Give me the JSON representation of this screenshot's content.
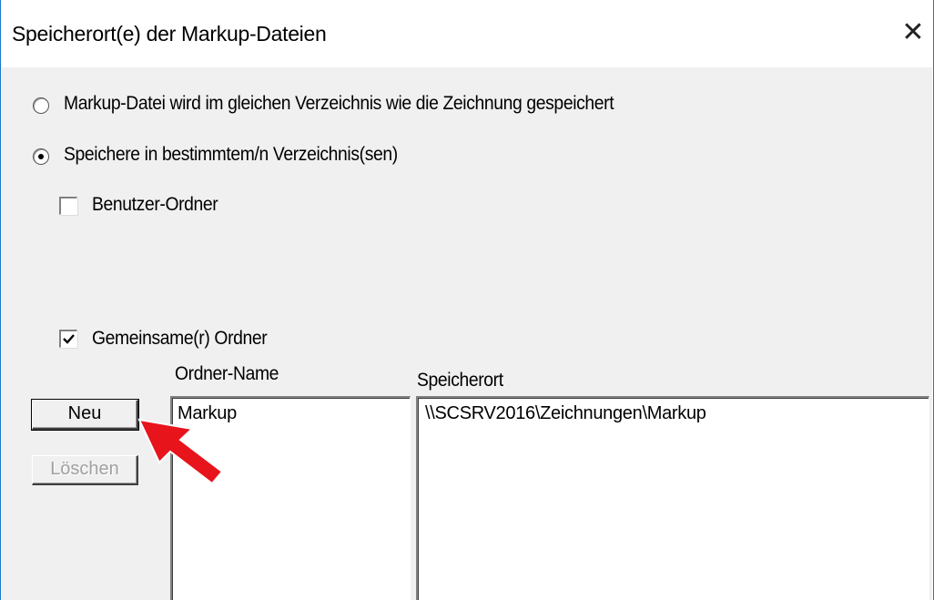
{
  "dialog": {
    "title": "Speicherort(e) der Markup-Dateien",
    "close_glyph": "✕"
  },
  "options": {
    "same_dir_label": "Markup-Datei wird im gleichen Verzeichnis wie die Zeichnung gespeichert",
    "same_dir_selected": false,
    "specific_dir_label": "Speichere in bestimmtem/n Verzeichnis(sen)",
    "specific_dir_selected": true,
    "user_folder_label": "Benutzer-Ordner",
    "user_folder_checked": false,
    "shared_folder_label": "Gemeinsame(r) Ordner",
    "shared_folder_checked": true
  },
  "buttons": {
    "new_label": "Neu",
    "delete_label": "Löschen"
  },
  "table": {
    "col_name_header": "Ordner-Name",
    "col_location_header": "Speicherort",
    "rows": [
      {
        "name": "Markup",
        "location": "\\\\SCSRV2016\\Zeichnungen\\Markup"
      }
    ]
  },
  "annotation": {
    "arrow_color": "#e8141b"
  }
}
